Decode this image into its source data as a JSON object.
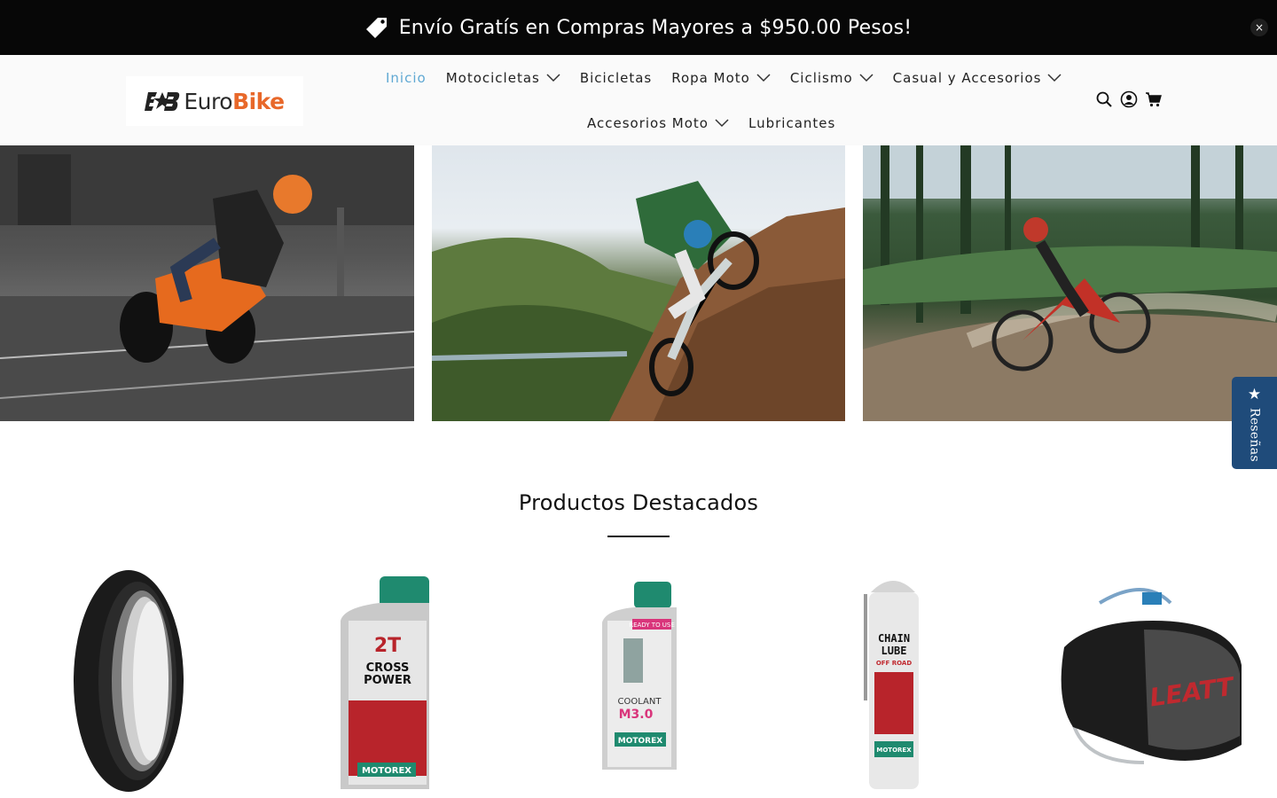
{
  "announcement": {
    "text": "Envío Gratís en Compras Mayores a $950.00 Pesos!",
    "close_symbol": "×"
  },
  "header": {
    "logo": {
      "part1": "Euro",
      "part2": "Bike"
    },
    "nav": [
      {
        "label": "Inicio",
        "active": true,
        "dropdown": false
      },
      {
        "label": "Motocicletas",
        "active": false,
        "dropdown": true
      },
      {
        "label": "Bicicletas",
        "active": false,
        "dropdown": false
      },
      {
        "label": "Ropa Moto",
        "active": false,
        "dropdown": true
      },
      {
        "label": "Ciclismo",
        "active": false,
        "dropdown": true
      },
      {
        "label": "Casual y Accesorios",
        "active": false,
        "dropdown": true
      },
      {
        "label": "Accesorios Moto",
        "active": false,
        "dropdown": true
      },
      {
        "label": "Lubricantes",
        "active": false,
        "dropdown": false
      }
    ],
    "icons": [
      "search-icon",
      "account-icon",
      "cart-icon"
    ]
  },
  "banners": [
    {
      "subject": "KTM naked motorcycle cornering"
    },
    {
      "subject": "Enduro dirt bike climbing rocks"
    },
    {
      "subject": "Mountain bike rider on forest trail"
    }
  ],
  "reviews_tab": {
    "star": "★",
    "label": "Reseñas"
  },
  "featured": {
    "title": "Productos Destacados",
    "products": [
      {
        "kind": "tire"
      },
      {
        "kind": "oil-bottle",
        "label_line1": "2T",
        "label_line2": "CROSS",
        "label_line3": "POWER",
        "brand": "MOTOREX"
      },
      {
        "kind": "coolant-bottle",
        "label_line1": "COOLANT",
        "label_line2": "M3.0",
        "brand": "MOTOREX",
        "top_label": "READY TO USE"
      },
      {
        "kind": "spray-can",
        "label_line1": "CHAIN",
        "label_line2": "LUBE",
        "label_line3": "OFF ROAD",
        "brand": "MOTOREX"
      },
      {
        "kind": "hydration-bag",
        "brand": "LEATT"
      }
    ]
  },
  "colors": {
    "announce_bg": "#070707",
    "nav_active": "#5fa8d3",
    "logo_orange": "#e8682a",
    "reviews_bg": "#1f4b7a"
  }
}
